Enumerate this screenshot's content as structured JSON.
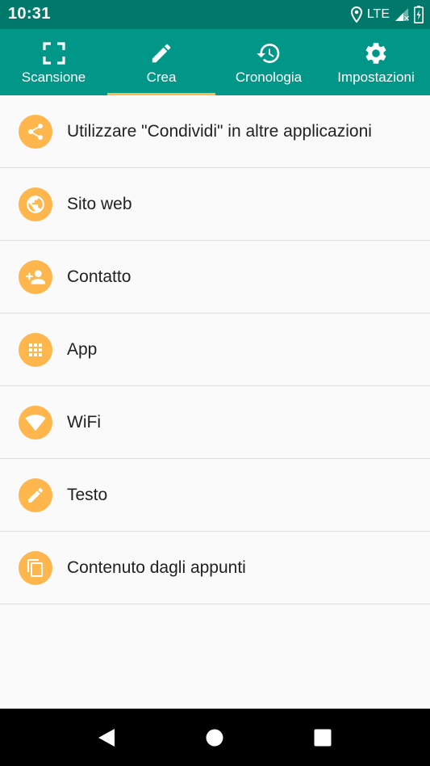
{
  "status_bar": {
    "time": "10:31",
    "network": "LTE"
  },
  "tabs": [
    {
      "label": "Scansione",
      "icon": "scan-frame-icon"
    },
    {
      "label": "Crea",
      "icon": "pencil-icon",
      "selected": true
    },
    {
      "label": "Cronologia",
      "icon": "history-icon"
    },
    {
      "label": "Impostazioni",
      "icon": "gear-icon"
    }
  ],
  "list": {
    "items": [
      {
        "label": "Utilizzare \"Condividi\" in altre applicazioni",
        "icon": "share-icon"
      },
      {
        "label": "Sito web",
        "icon": "globe-icon"
      },
      {
        "label": "Contatto",
        "icon": "add-person-icon"
      },
      {
        "label": "App",
        "icon": "apps-grid-icon"
      },
      {
        "label": "WiFi",
        "icon": "wifi-icon"
      },
      {
        "label": "Testo",
        "icon": "pencil-icon"
      },
      {
        "label": "Contenuto dagli appunti",
        "icon": "clipboard-copy-icon"
      }
    ]
  },
  "colors": {
    "status_bar": "#00796b",
    "tab_bar": "#009688",
    "accent": "#ffb74d",
    "background": "#fafafa",
    "nav_bar": "#000000"
  }
}
